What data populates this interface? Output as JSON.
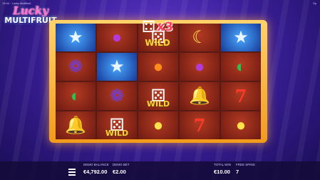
{
  "window": {
    "title": "13:44 · Lucky Multifruit",
    "badge": "Sp"
  },
  "logo": {
    "line1": "Lucky",
    "line2": "MULTIFRUIT"
  },
  "multiplier": {
    "text": "x3",
    "label": "WILD"
  },
  "grid": [
    [
      "star",
      "plum",
      "dice",
      "banana",
      "star"
    ],
    [
      "grapes",
      "star",
      "orange",
      "plum",
      "watermelon"
    ],
    [
      "watermelon",
      "grapes",
      "wild-dice",
      "bell",
      "seven"
    ],
    [
      "bell",
      "wild-dice",
      "lemon",
      "seven",
      "lemon"
    ]
  ],
  "wild_label": "WILD",
  "bottom": {
    "demo_balance_label": "DEMO BALANCE",
    "demo_balance_value": "€4,792.00",
    "demo_bet_label": "DEMO BET",
    "demo_bet_value": "€2.00",
    "total_win_label": "TOTAL WIN",
    "total_win_value": "€10.00",
    "free_spins_label": "FREE SPINS",
    "free_spins_value": "7"
  }
}
